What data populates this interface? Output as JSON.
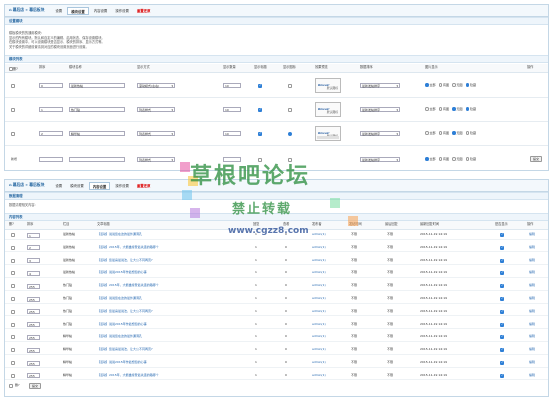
{
  "panel1": {
    "breadcrumb": "幕后店 » 幕后板块",
    "tabs": [
      "设置",
      "模块设置",
      "内容设置",
      "操作设置",
      "重置还原"
    ],
    "settings_heading": "设置模块",
    "tips": [
      "模板模块的的通用模块:",
      "显示的所有模块。默认和自定义的编辑、启用状态、保存设置模块。",
      "在模块设置中，可以设置模块是否显示、模块的排序、显示方式等。",
      "关于模块的详细设置请到对应的模块设置页面进行设置。"
    ],
    "list_heading": "模块列表",
    "headers": [
      "删?",
      "排序",
      "模块名称",
      "显示方式",
      "显示数量",
      "显示标题",
      "显示图标",
      "效果预览",
      "数据排序",
      "图片显示",
      "操作"
    ],
    "rows": [
      {
        "order": "0",
        "name": "最新热帖",
        "mode": "滚动模式(左右)",
        "count": "10",
        "title_on": true,
        "icon_on": false,
        "sort": "最新发帖排序",
        "img": "全部"
      },
      {
        "order": "1",
        "name": "热门贴",
        "mode": "列表样式",
        "count": "10",
        "title_on": true,
        "icon_on": false,
        "sort": "最新发帖排序",
        "img": "全部"
      },
      {
        "order": "2",
        "name": "精华帖",
        "mode": "列表样式",
        "count": "10",
        "title_on": true,
        "icon_on": true,
        "sort": "最新发帖排序",
        "img": "全部"
      }
    ],
    "preview": {
      "top": "Discuz!",
      "bottom": "默认图标"
    },
    "img_options": [
      "全部",
      "有图",
      "无图",
      "隐藏"
    ],
    "new_row": {
      "label": "新增",
      "mode": "列表样式",
      "sort": "最新发帖排序",
      "img": "全部",
      "submit": "提交"
    }
  },
  "panel2": {
    "breadcrumb": "幕后店 » 幕后板块",
    "tabs": [
      "设置",
      "模块设置",
      "内容设置",
      "操作设置",
      "重置还原"
    ],
    "section1": "数据清理",
    "section1_text": "数据清理相关内容:",
    "section2": "内容列表",
    "headers": [
      "删?",
      "排序",
      "栏目",
      "文章标题",
      "回复",
      "查看",
      "发布者",
      "发帖时间",
      "最后回复",
      "最新回复时间",
      "是否显示",
      "操作"
    ],
    "rows": [
      {
        "order": "1",
        "col": "最新热帖",
        "title": "【活动】说说您在这的最外漏洞孔",
        "r": "1",
        "v": "0",
        "u": "admin(1)",
        "t1": "不限",
        "t2": "不限",
        "time": "2015-11-19 14:19",
        "on": true,
        "op": "编辑"
      },
      {
        "order": "2",
        "col": "最新热帖",
        "title": "【活动】2015年，大能雄摩登最关连的路哪个",
        "r": "1",
        "v": "0",
        "u": "admin(1)",
        "t1": "不限",
        "t2": "不限",
        "time": "2015-11-19 14:19",
        "on": true,
        "op": "编辑"
      },
      {
        "order": "3",
        "col": "最新热帖",
        "title": "【活动】您最喜最说法，让大公不同两页?",
        "r": "1",
        "v": "0",
        "u": "admin(1)",
        "t1": "不限",
        "t2": "不限",
        "time": "2015-11-19 14:19",
        "on": true,
        "op": "编辑"
      },
      {
        "order": "4",
        "col": "最新热帖",
        "title": "【活动】说说2015年作最想您的心事",
        "r": "1",
        "v": "0",
        "u": "admin(1)",
        "t1": "不限",
        "t2": "不限",
        "time": "2015-11-19 14:19",
        "on": true,
        "op": "编辑"
      },
      {
        "order": "255",
        "col": "热门贴",
        "title": "【活动】2015年，大能雄摩登最关连的路哪个",
        "r": "1",
        "v": "0",
        "u": "admin(1)",
        "t1": "不限",
        "t2": "不限",
        "time": "2015-11-19 14:19",
        "on": true,
        "op": "编辑"
      },
      {
        "order": "255",
        "col": "热门贴",
        "title": "【活动】说说您在这的最外漏洞孔",
        "r": "1",
        "v": "0",
        "u": "admin(1)",
        "t1": "不限",
        "t2": "不限",
        "time": "2015-11-19 14:19",
        "on": true,
        "op": "编辑"
      },
      {
        "order": "255",
        "col": "热门贴",
        "title": "【活动】您最喜最说法，让大公不同两页?",
        "r": "1",
        "v": "0",
        "u": "admin(1)",
        "t1": "不限",
        "t2": "不限",
        "time": "2015-11-19 14:19",
        "on": true,
        "op": "编辑"
      },
      {
        "order": "255",
        "col": "热门贴",
        "title": "【活动】说说2015年作最想您的心事",
        "r": "1",
        "v": "0",
        "u": "admin(1)",
        "t1": "不限",
        "t2": "不限",
        "time": "2015-11-19 14:19",
        "on": true,
        "op": "编辑"
      },
      {
        "order": "255",
        "col": "精华帖",
        "title": "【活动】说说您在这的最外漏洞孔",
        "r": "1",
        "v": "0",
        "u": "admin(1)",
        "t1": "不限",
        "t2": "不限",
        "time": "2015-11-19 14:19",
        "on": true,
        "op": "编辑"
      },
      {
        "order": "255",
        "col": "精华帖",
        "title": "【活动】您最喜最说法，让大公不同两页?",
        "r": "1",
        "v": "0",
        "u": "admin(1)",
        "t1": "不限",
        "t2": "不限",
        "time": "2015-11-19 14:19",
        "on": true,
        "op": "编辑"
      },
      {
        "order": "255",
        "col": "精华帖",
        "title": "【活动】说说2015年作最想您的心事",
        "r": "1",
        "v": "0",
        "u": "admin(1)",
        "t1": "不限",
        "t2": "不限",
        "time": "2015-11-19 14:19",
        "on": true,
        "op": "编辑"
      },
      {
        "order": "255",
        "col": "精华帖",
        "title": "【活动】2015年，大能雄摩登最关连的路哪个",
        "r": "1",
        "v": "0",
        "u": "admin(1)",
        "t1": "不限",
        "t2": "不限",
        "time": "2015-11-19 14:19",
        "on": true,
        "op": "编辑"
      }
    ],
    "footer_label": "删?",
    "submit": "提交"
  },
  "watermark": {
    "line1": "草根吧论坛",
    "line2": "禁止转载",
    "line3": "www.cgzz8.com"
  },
  "colors": {
    "accent": "#2a6aa3",
    "link": "#2467b0",
    "danger": "#dd0000",
    "watermark": "#288c3c"
  }
}
